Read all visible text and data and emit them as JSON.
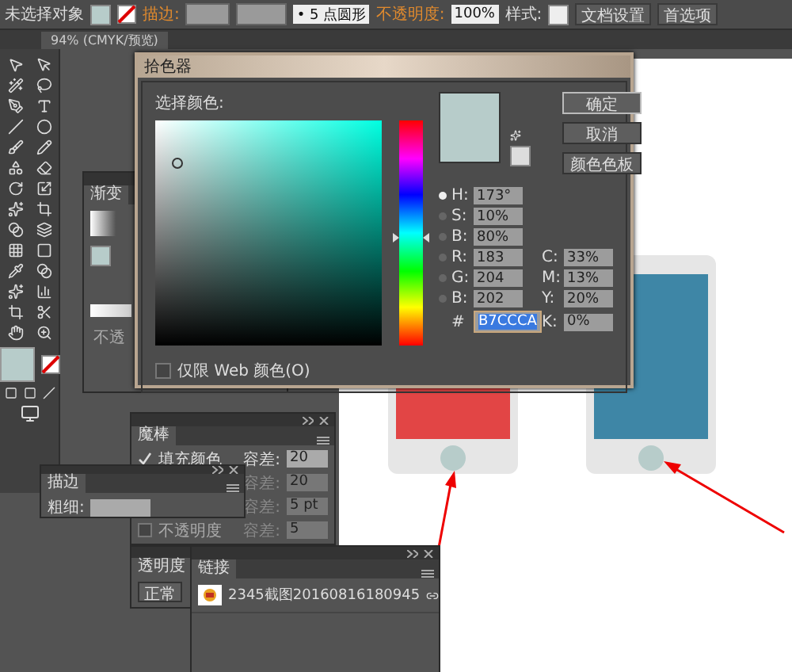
{
  "control_bar": {
    "selection": "未选择对象",
    "stroke_label": "描边:",
    "brush": "• 5 点圆形",
    "opacity_label": "不透明度:",
    "opacity": "100%",
    "style_label": "样式:",
    "buttons": [
      "文档设置",
      "首选项"
    ]
  },
  "document_tab": {
    "title": "94% (CMYK/预览)"
  },
  "color_picker": {
    "title": "拾色器",
    "prompt": "选择颜色:",
    "color": "#b7ccca",
    "hue_slider": {
      "level": 0.52
    },
    "buttons": [
      {
        "label": "确定",
        "selected": true
      },
      {
        "label": "取消",
        "selected": false
      },
      {
        "label": "颜色色板",
        "selected": false
      }
    ],
    "fields": [
      {
        "label": "H:",
        "value": "173°",
        "selected": true
      },
      {
        "label": "S:",
        "value": "10%",
        "selected": false
      },
      {
        "label": "B:",
        "value": "80%",
        "selected": false
      },
      {
        "label": "R:",
        "value": "183",
        "selected": false
      },
      {
        "label": "G:",
        "value": "204",
        "selected": false
      },
      {
        "label": "B:",
        "value": "202",
        "selected": false
      }
    ],
    "hex": {
      "label": "#",
      "value": "B7CCCA"
    },
    "cmyk": [
      {
        "label": "C:",
        "value": "33%"
      },
      {
        "label": "M:",
        "value": "13%"
      },
      {
        "label": "Y:",
        "value": "20%"
      },
      {
        "label": "K:",
        "value": "0%"
      }
    ],
    "web_only": {
      "label": "仅限 Web 颜色(O)",
      "checked": false
    }
  },
  "gradient_panel": {
    "title": "渐变",
    "opacity_label": "不透"
  },
  "magic_wand_panel": {
    "title": "魔棒",
    "rows": [
      {
        "label": "填充颜色",
        "checked": true,
        "tolerance_label": "容差:",
        "tolerance": "20",
        "disabled": false
      },
      {
        "tolerance_label": "容差:",
        "tolerance": "20",
        "disabled": true
      },
      {
        "tolerance_label": "容差:",
        "tolerance": "5 pt",
        "disabled": true
      },
      {
        "label": "不透明度",
        "checked": false,
        "tolerance_label": "容差:",
        "tolerance": "5",
        "disabled": true
      }
    ]
  },
  "stroke_panel": {
    "title": "描边",
    "weight_label": "粗细:"
  },
  "transparency_panel": {
    "title": "透明度",
    "mode": "正常"
  },
  "links_panel": {
    "title": "链接",
    "items": [
      {
        "name": "2345截图20160816180945"
      }
    ]
  },
  "artboard": {
    "phones": [
      {
        "color": "#e24545"
      },
      {
        "color": "#3e86a6"
      }
    ]
  }
}
